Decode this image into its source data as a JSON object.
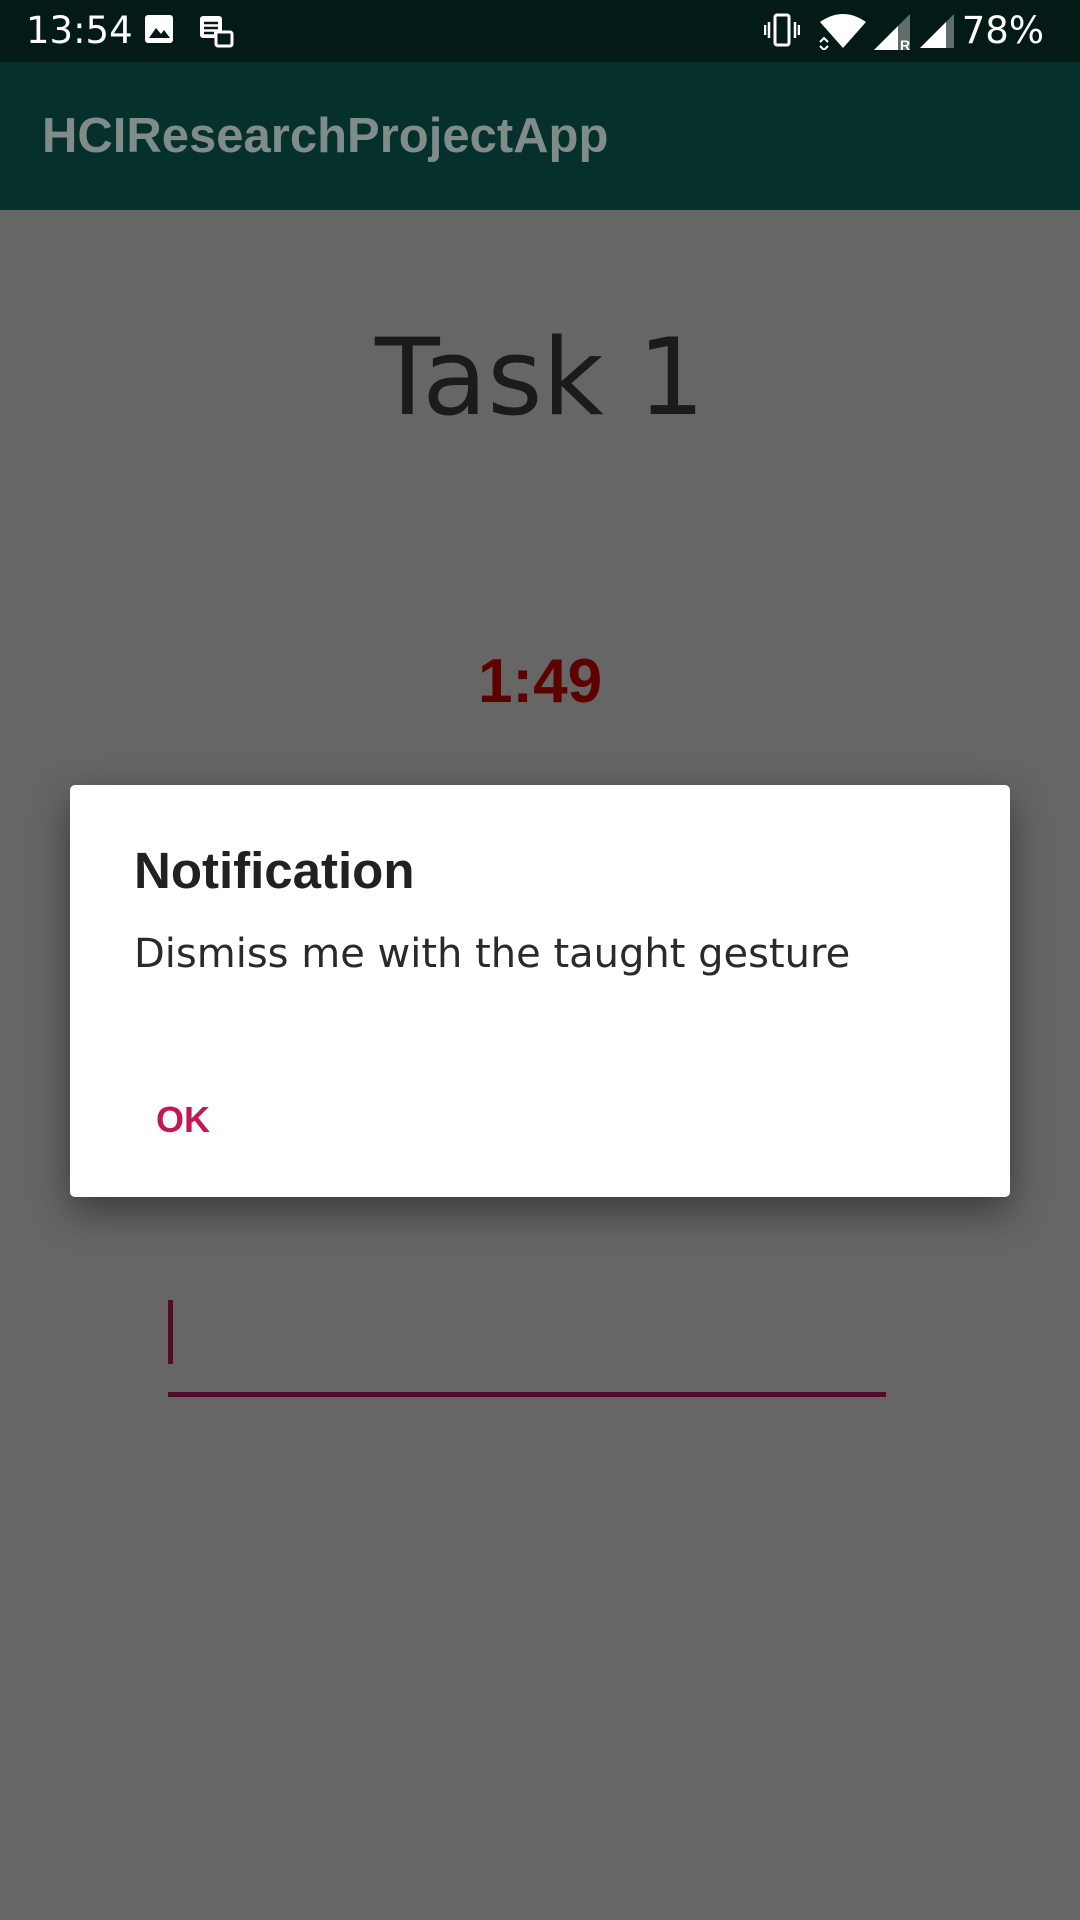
{
  "status_bar": {
    "time": "13:54",
    "battery": "78%",
    "icons": [
      "image-icon",
      "task-icon",
      "vibrate-icon",
      "wifi-icon",
      "signal-roaming-icon",
      "signal-icon"
    ]
  },
  "app_bar": {
    "title": "HCIResearchProjectApp"
  },
  "main": {
    "task_title": "Task 1",
    "timer": "1:49",
    "input_value": ""
  },
  "dialog": {
    "title": "Notification",
    "message": "Dismiss me with the taught gesture",
    "ok_label": "OK"
  },
  "colors": {
    "status_bar_bg": "#041a16",
    "app_bar_bg": "#05302b",
    "scrim_bg": "#666666",
    "timer": "#5e0000",
    "accent": "#c2185b",
    "input_underline": "#540b2a"
  }
}
